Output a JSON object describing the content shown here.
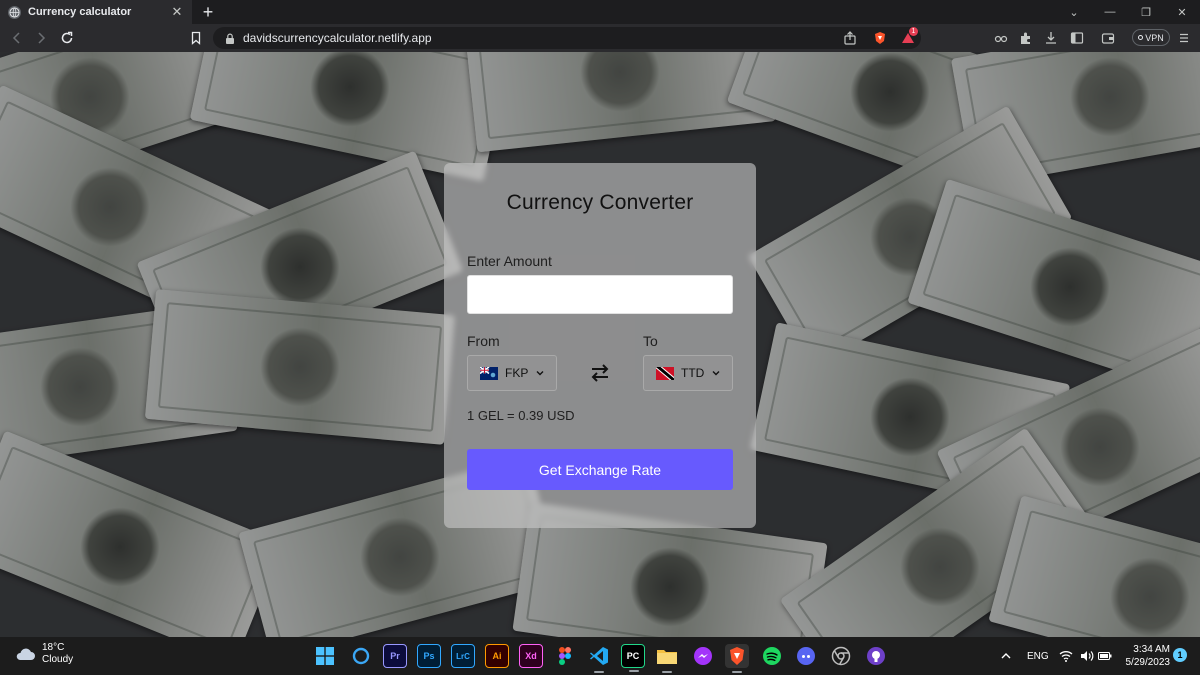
{
  "browser": {
    "tab_title": "Currency calculator",
    "url": "davidscurrencycalculator.netlify.app",
    "vpn_label": "VPN",
    "new_tab_label": "+",
    "tab_close_label": "✕",
    "brave_badge": "1"
  },
  "converter": {
    "title": "Currency Converter",
    "amount_label": "Enter Amount",
    "amount_value": "",
    "from_label": "From",
    "to_label": "To",
    "from_currency": "FKP",
    "to_currency": "TTD",
    "rate_text": "1 GEL = 0.39 USD",
    "button_label": "Get Exchange Rate",
    "accent_color": "#675afe"
  },
  "taskbar": {
    "weather_temp": "18°C",
    "weather_condition": "Cloudy",
    "apps": [
      {
        "name": "start",
        "label": ""
      },
      {
        "name": "cortana",
        "label": ""
      },
      {
        "name": "premiere-pro",
        "label": "Pr"
      },
      {
        "name": "photoshop",
        "label": "Ps"
      },
      {
        "name": "lightroom-classic",
        "label": "LrC"
      },
      {
        "name": "illustrator",
        "label": "Ai"
      },
      {
        "name": "xd",
        "label": "Xd"
      },
      {
        "name": "figma",
        "label": ""
      },
      {
        "name": "vs-code",
        "label": ""
      },
      {
        "name": "pycharm",
        "label": "PC"
      },
      {
        "name": "file-explorer",
        "label": ""
      },
      {
        "name": "messenger",
        "label": ""
      },
      {
        "name": "brave",
        "label": ""
      },
      {
        "name": "spotify",
        "label": ""
      },
      {
        "name": "discord",
        "label": ""
      },
      {
        "name": "chrome-dev",
        "label": ""
      },
      {
        "name": "github-desktop",
        "label": ""
      }
    ],
    "language": "ENG",
    "time": "3:34 AM",
    "date": "5/29/2023",
    "notification_count": "1"
  }
}
